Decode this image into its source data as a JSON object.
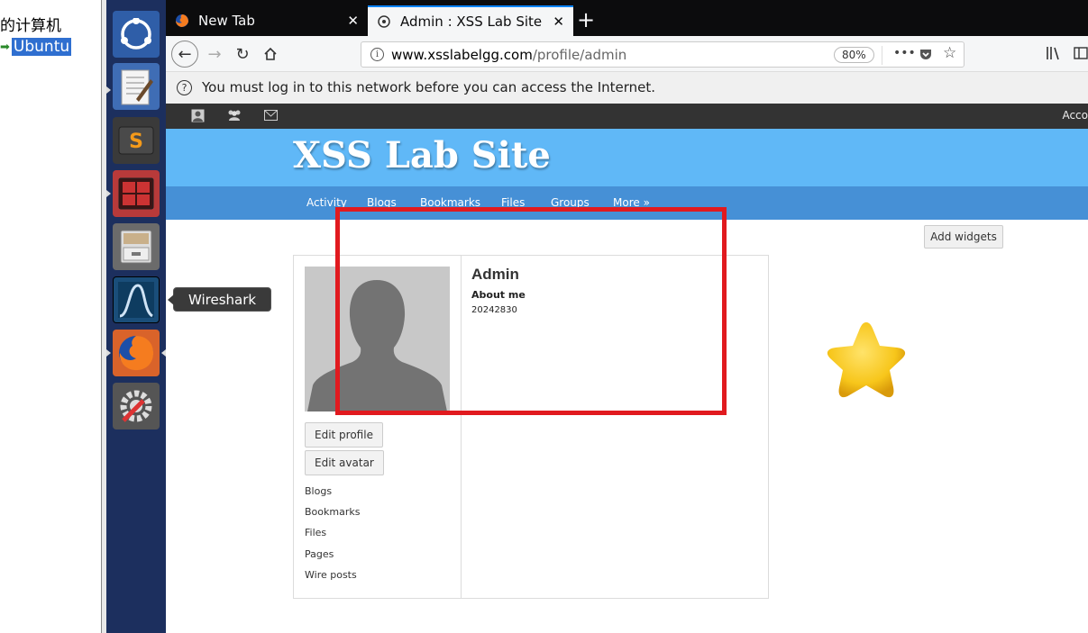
{
  "host": {
    "title_text": "的计算机",
    "item_label": "Ubuntu"
  },
  "launcher": {
    "tooltip": "Wireshark",
    "apps": [
      "ubuntu-dash",
      "text-editor",
      "sublime-text",
      "terminal",
      "file-manager",
      "wireshark",
      "firefox",
      "system-settings"
    ]
  },
  "browser": {
    "tabs": [
      {
        "title": "New Tab",
        "close": "✕"
      },
      {
        "title": "Admin : XSS Lab Site",
        "close": "✕"
      }
    ],
    "new_tab": "+",
    "url_host": "www.xsslabelgg.com",
    "url_path": "/profile/admin",
    "zoom": "80%",
    "more": "•••",
    "notification": "You must log in to this network before you can access the Internet."
  },
  "site": {
    "account_label": "Acco",
    "title": "XSS Lab Site",
    "menu": [
      "Activity",
      "Blogs",
      "Bookmarks",
      "Files",
      "Groups",
      "More »"
    ],
    "add_widgets": "Add widgets",
    "profile": {
      "name": "Admin",
      "about_label": "About me",
      "about_value": "20242830",
      "buttons": {
        "edit_profile": "Edit profile",
        "edit_avatar": "Edit avatar"
      },
      "links": [
        "Blogs",
        "Bookmarks",
        "Files",
        "Pages",
        "Wire posts"
      ]
    }
  },
  "colors": {
    "header": "#60b8f7",
    "menubar": "#4690d6",
    "topbar": "#333333",
    "launcher": "#1c2f5e",
    "highlight": "#e11a1f",
    "star": "#f7c61b"
  }
}
